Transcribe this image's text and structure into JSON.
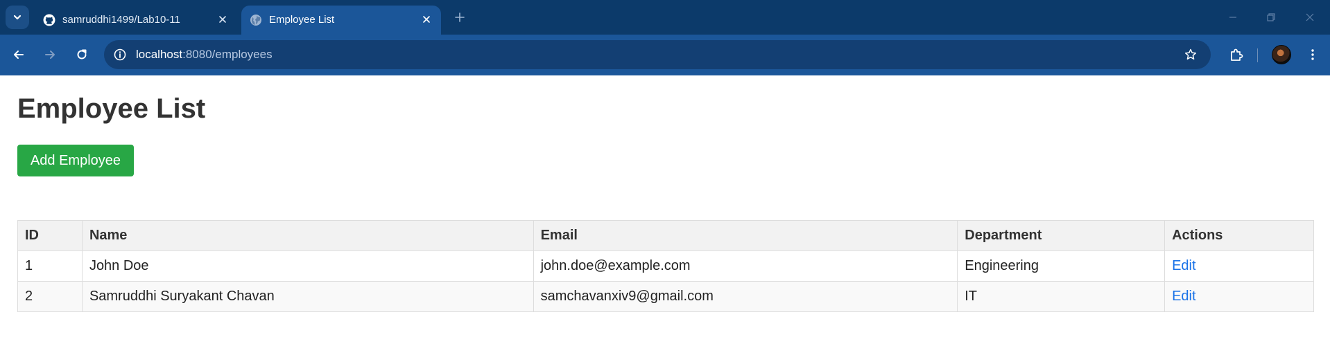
{
  "browser": {
    "tabs": [
      {
        "title": "samruddhi1499/Lab10-11",
        "icon": "github-icon",
        "active": false
      },
      {
        "title": "Employee List",
        "icon": "globe-icon",
        "active": true
      }
    ],
    "url_host": "localhost",
    "url_rest": ":8080/employees"
  },
  "page": {
    "title": "Employee List",
    "add_button": "Add Employee"
  },
  "table": {
    "headers": [
      "ID",
      "Name",
      "Email",
      "Department",
      "Actions"
    ],
    "rows": [
      {
        "id": "1",
        "name": "John Doe",
        "email": "john.doe@example.com",
        "department": "Engineering",
        "action": "Edit"
      },
      {
        "id": "2",
        "name": "Samruddhi Suryakant Chavan",
        "email": "samchavanxiv9@gmail.com",
        "department": "IT",
        "action": "Edit"
      }
    ]
  },
  "colors": {
    "tabstrip": "#0c3a6a",
    "toolbar": "#1b5699",
    "add_button": "#28a745",
    "link": "#1a73e8"
  }
}
